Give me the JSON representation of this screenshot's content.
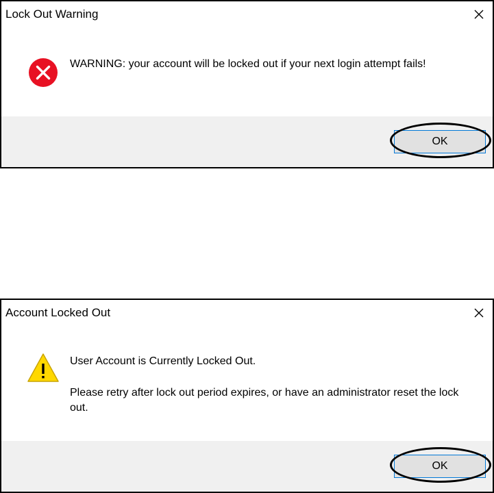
{
  "dialogs": [
    {
      "title": "Lock Out Warning",
      "icon": "error-icon",
      "message": "WARNING: your account will be locked out if your next login attempt fails!",
      "ok_label": "OK"
    },
    {
      "title": "Account Locked Out",
      "icon": "warning-icon",
      "message_line1": "User Account is Currently Locked Out.",
      "message_line2": "Please retry after lock out period expires, or have an administrator reset the lock out.",
      "ok_label": "OK"
    }
  ],
  "colors": {
    "error_red": "#e81123",
    "warning_yellow": "#ffd800",
    "focus_blue": "#0078d7",
    "footer_gray": "#f0f0f0",
    "button_gray": "#e1e1e1"
  }
}
